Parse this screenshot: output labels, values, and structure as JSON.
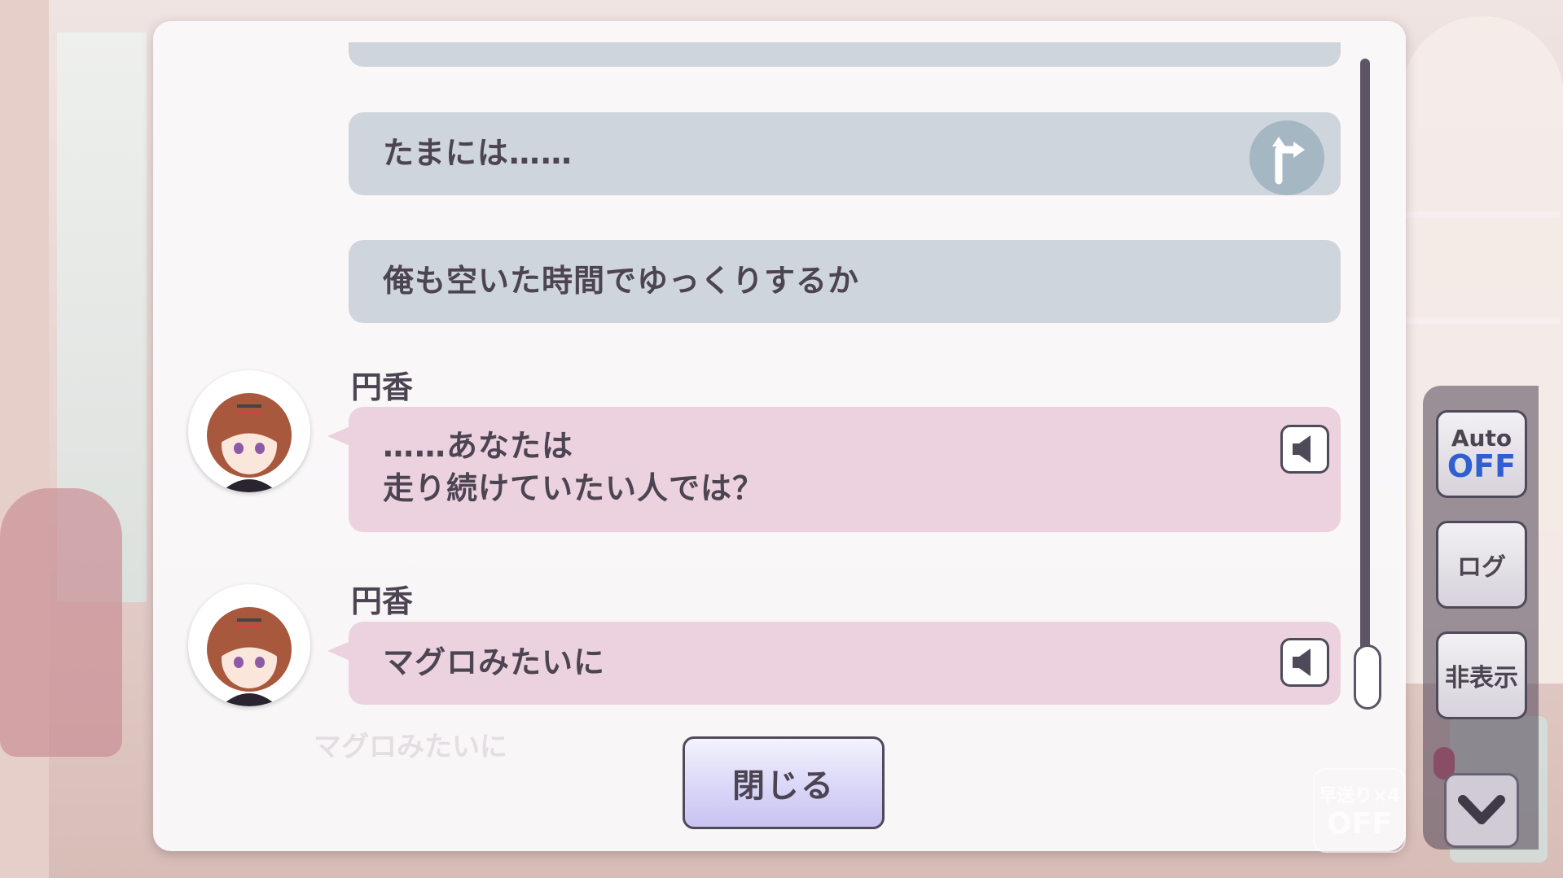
{
  "log": {
    "messages": [
      {
        "type": "choice",
        "text": "たまには……",
        "icon": "branch-arrow-icon"
      },
      {
        "type": "choice",
        "text": "俺も空いた時間でゆっくりするか"
      },
      {
        "type": "speech",
        "speaker": "円香",
        "lines": [
          "……あなたは",
          "走り続けていたい人では？"
        ],
        "icon": "speaker-icon"
      },
      {
        "type": "speech",
        "speaker": "円香",
        "lines": [
          "マグロみたいに"
        ],
        "icon": "speaker-icon"
      }
    ],
    "background_line": "マグロみたいに",
    "close_label": "閉じる"
  },
  "side_menu": {
    "auto_label": "Auto",
    "auto_state": "OFF",
    "log_label": "ログ",
    "hide_label": "非表示",
    "fast_forward_label": "早送り×4",
    "fast_forward_state": "OFF",
    "collapse_icon": "chevron-down-icon"
  },
  "colors": {
    "choice_bubble": "#cfd5dc",
    "speech_bubble": "#ebd2de",
    "auto_off": "#2f5fd1",
    "text": "#4c4452"
  }
}
